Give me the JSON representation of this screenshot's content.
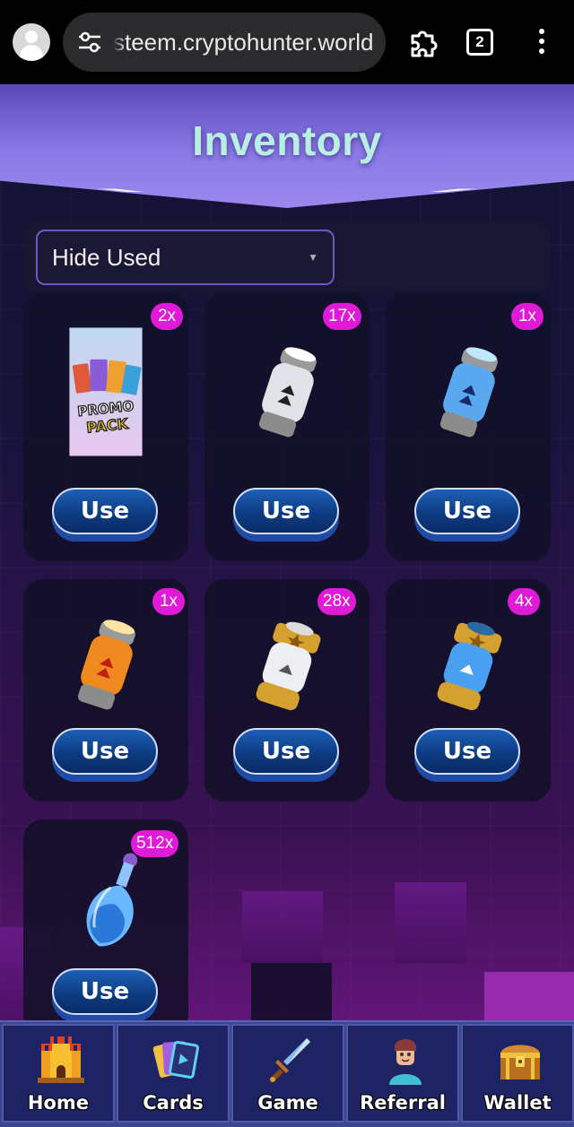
{
  "browser": {
    "url": "steem.cryptohunter.world",
    "tab_count": "2"
  },
  "page": {
    "title": "Inventory",
    "filter": {
      "selected": "Hide Used"
    }
  },
  "inventory": [
    {
      "name": "promo-pack",
      "count": "2x",
      "button": "Use",
      "label_art": "PROMO PACK"
    },
    {
      "name": "silver-capsule",
      "count": "17x",
      "button": "Use"
    },
    {
      "name": "blue-capsule",
      "count": "1x",
      "button": "Use"
    },
    {
      "name": "orange-capsule",
      "count": "1x",
      "button": "Use"
    },
    {
      "name": "gold-silver-capsule",
      "count": "28x",
      "button": "Use"
    },
    {
      "name": "gold-blue-capsule",
      "count": "4x",
      "button": "Use"
    },
    {
      "name": "potion",
      "count": "512x",
      "button": "Use"
    }
  ],
  "nav": [
    {
      "label": "Home",
      "icon": "castle-icon"
    },
    {
      "label": "Cards",
      "icon": "cards-icon"
    },
    {
      "label": "Game",
      "icon": "sword-icon"
    },
    {
      "label": "Referral",
      "icon": "person-icon"
    },
    {
      "label": "Wallet",
      "icon": "treasure-chest-icon"
    }
  ],
  "colors": {
    "badge": "#e01ad6",
    "banner": "#8b79e6",
    "title": "#b7f0e2",
    "button": "#0d3c82",
    "nav": "#1e2364"
  }
}
